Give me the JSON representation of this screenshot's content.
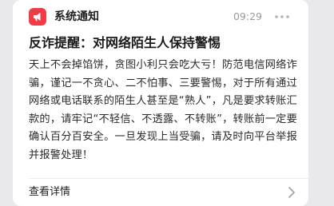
{
  "notification": {
    "app_name": "系统通知",
    "time": "09:29",
    "title": "反诈提醒：对网络陌生人保持警惕",
    "body": "天上不会掉馅饼，贪图小利只会吃大亏！防范电信网络诈骗，谨记一不贪心、二不怕事、三要警惕，对于所有通过网络或电话联系的陌生人甚至是“熟人”，凡是要求转账汇款的，请牢记“不轻信、不透露、不转账”，转账前一定要确认百分百安全。一旦发现上当受骗，请及时向平台举报并报警处理！",
    "footer_label": "查看详情"
  },
  "icons": {
    "app_icon": "megaphone-icon",
    "more": "more-options-icon",
    "chevron": "chevron-right-icon"
  },
  "colors": {
    "accent": "#f23b46",
    "background": "#e9e9ec",
    "card": "#ffffff",
    "time_text": "#9a9a9a"
  }
}
